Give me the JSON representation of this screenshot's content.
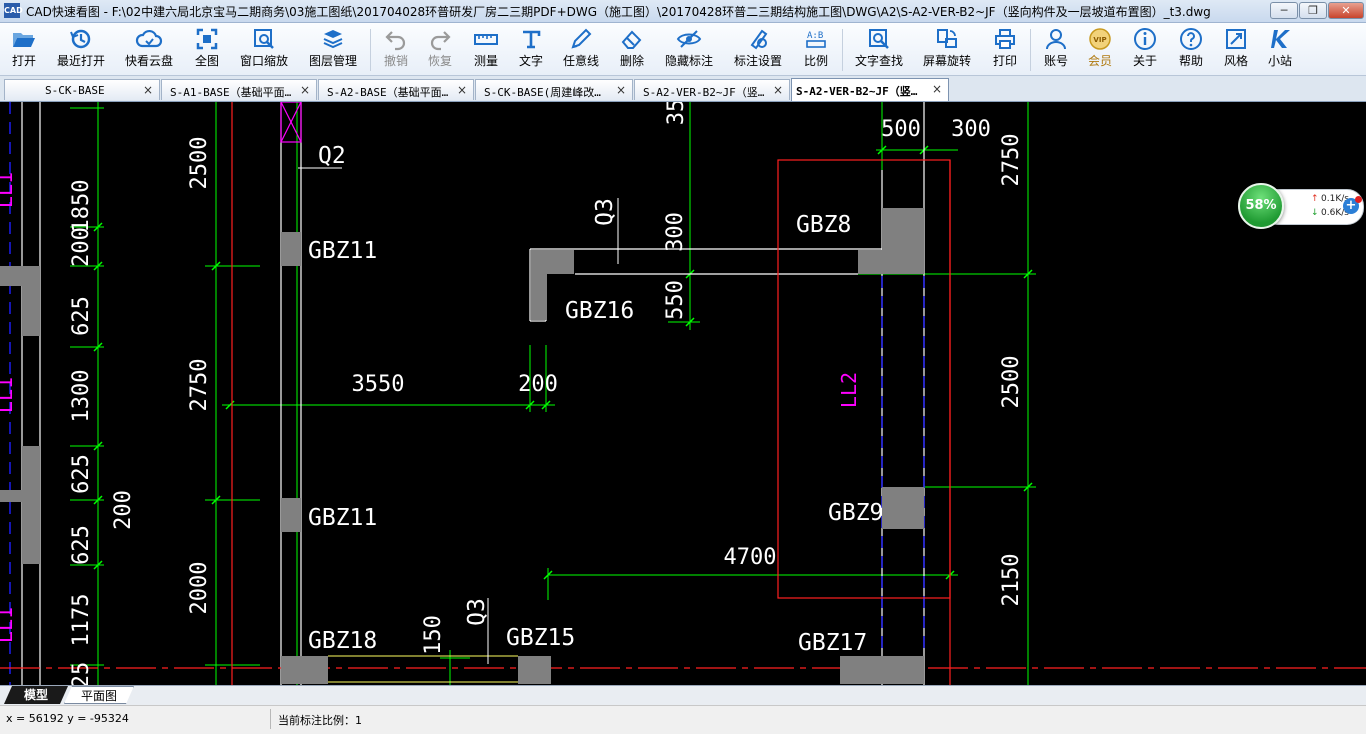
{
  "window": {
    "app_icon": "CAD",
    "title": "CAD快速看图 - F:\\02中建六局北京宝马二期商务\\03施工图纸\\201704028环普研发厂房二三期PDF+DWG（施工图）\\20170428环普二三期结构施工图\\DWG\\A2\\S-A2-VER-B2~JF（竖向构件及一层坡道布置图）_t3.dwg",
    "min_label": "─",
    "max_label": "❐",
    "close_label": "✕"
  },
  "toolbar": {
    "buttons": [
      {
        "label": "打开",
        "icon": "folder-open-icon"
      },
      {
        "label": "最近打开",
        "icon": "recent-icon"
      },
      {
        "label": "快看云盘",
        "icon": "cloud-icon"
      },
      {
        "label": "全图",
        "icon": "fullview-icon"
      },
      {
        "label": "窗口缩放",
        "icon": "window-zoom-icon"
      },
      {
        "label": "图层管理",
        "icon": "layers-icon"
      },
      {
        "label": "撤销",
        "icon": "undo-icon"
      },
      {
        "label": "恢复",
        "icon": "redo-icon"
      },
      {
        "label": "测量",
        "icon": "measure-icon"
      },
      {
        "label": "文字",
        "icon": "text-icon"
      },
      {
        "label": "任意线",
        "icon": "pen-icon"
      },
      {
        "label": "删除",
        "icon": "eraser-icon"
      },
      {
        "label": "隐藏标注",
        "icon": "eye-icon"
      },
      {
        "label": "标注设置",
        "icon": "annotation-settings-icon"
      },
      {
        "label": "比例",
        "icon": "scale-icon"
      },
      {
        "label": "文字查找",
        "icon": "text-search-icon"
      },
      {
        "label": "屏幕旋转",
        "icon": "rotate-screen-icon"
      },
      {
        "label": "打印",
        "icon": "printer-icon"
      },
      {
        "label": "账号",
        "icon": "user-icon"
      },
      {
        "label": "会员",
        "icon": "vip-icon"
      },
      {
        "label": "关于",
        "icon": "info-icon"
      },
      {
        "label": "帮助",
        "icon": "help-icon"
      },
      {
        "label": "风格",
        "icon": "style-icon"
      },
      {
        "label": "小站",
        "icon": "station-icon"
      }
    ],
    "colors": {
      "icon_blue": "#1e6fc8",
      "disabled_gray": "#9a9a9a",
      "vip_gold": "#c89a20"
    }
  },
  "tabs": [
    {
      "label": "S-CK-BASE",
      "close": "×"
    },
    {
      "label": "S-A1-BASE（基础平面…",
      "close": "×"
    },
    {
      "label": "S-A2-BASE（基础平面…",
      "close": "×"
    },
    {
      "label": "S-CK-BASE(周建峰改…",
      "close": "×"
    },
    {
      "label": "S-A2-VER-B2~JF（竖…",
      "close": "×"
    },
    {
      "label": "S-A2-VER-B2~JF（竖…",
      "close": "×"
    }
  ],
  "drawing": {
    "colors": {
      "background": "#000000",
      "dimension": "#00ff00",
      "wall": "#ffffff",
      "column_fill": "#808080",
      "red_line": "#ff2020",
      "magenta": "#ff00ff",
      "blue_dash": "#2020ff",
      "yellow": "#ffff60"
    },
    "dimensions": {
      "left_1850": "1850",
      "left_200a": "200",
      "left_625a": "625",
      "left_1300": "1300",
      "left_625b": "625",
      "left_625c": "625",
      "left_1175": "1175",
      "left_25": "25",
      "left_200b": "200",
      "col_2500": "2500",
      "col_2750": "2750",
      "col_2000": "2000",
      "top_35": "35",
      "d_3550": "3550",
      "d_200": "200",
      "d_300": "300",
      "d_550": "550",
      "d_500": "500",
      "d_300_top": "300",
      "right_2750": "2750",
      "right_2500": "2500",
      "right_2150": "2150",
      "d_4700": "4700",
      "d_150": "150"
    },
    "labels": {
      "q2": "Q2",
      "q3a": "Q3",
      "q3b": "Q3",
      "gbz11a": "GBZ11",
      "gbz11b": "GBZ11",
      "gbz16": "GBZ16",
      "gbz8": "GBZ8",
      "gbz9": "GBZ9",
      "gbz18": "GBZ18",
      "gbz15": "GBZ15",
      "gbz17": "GBZ17",
      "ll2": "LL2",
      "ll1a": "LL1",
      "ll1b": "LL1",
      "ll1c": "LL1"
    }
  },
  "layout_tabs": {
    "model": "模型",
    "plan": "平面图"
  },
  "status": {
    "coords": "x = 56192  y = -95324",
    "scale": "当前标注比例：1"
  },
  "speed_widget": {
    "percent": "58%",
    "up": "0.1K/s",
    "down": "0.6K/s",
    "up_arrow": "↑",
    "down_arrow": "↓",
    "plus": "+"
  }
}
